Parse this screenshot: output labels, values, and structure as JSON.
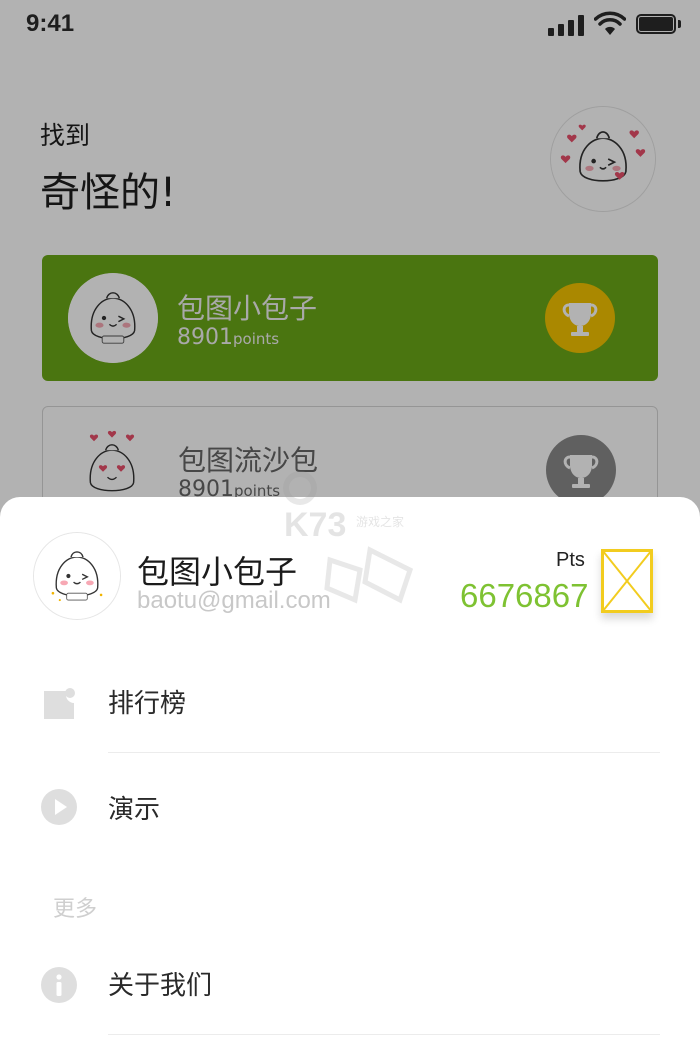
{
  "status_bar": {
    "time": "9:41"
  },
  "header": {
    "greeting_line1": "找到",
    "greeting_line2": "奇怪的!"
  },
  "leaderboard_cards": [
    {
      "name": "包图小包子",
      "points": "8901",
      "points_unit": "points",
      "highlight": true
    },
    {
      "name": "包图流沙包",
      "points": "8901",
      "points_unit": "points",
      "highlight": false
    }
  ],
  "profile_sheet": {
    "name": "包图小包子",
    "email": "baotu@gmail.com",
    "pts_label": "Pts",
    "pts_value": "6676867"
  },
  "menu": {
    "items": [
      {
        "label": "排行榜",
        "icon": "leaderboard-icon"
      },
      {
        "label": "演示",
        "icon": "play-icon"
      }
    ],
    "more_section_label": "更多",
    "more_items": [
      {
        "label": "关于我们",
        "icon": "info-icon"
      }
    ]
  },
  "watermark": {
    "text": "K73",
    "subtext": "游戏之家"
  },
  "colors": {
    "card_highlight": "#6aa817",
    "trophy_gold": "#f4c300",
    "trophy_gray": "#8a8a8a",
    "points_green": "#7ec232",
    "placeholder_yellow": "#f2cc1f"
  }
}
